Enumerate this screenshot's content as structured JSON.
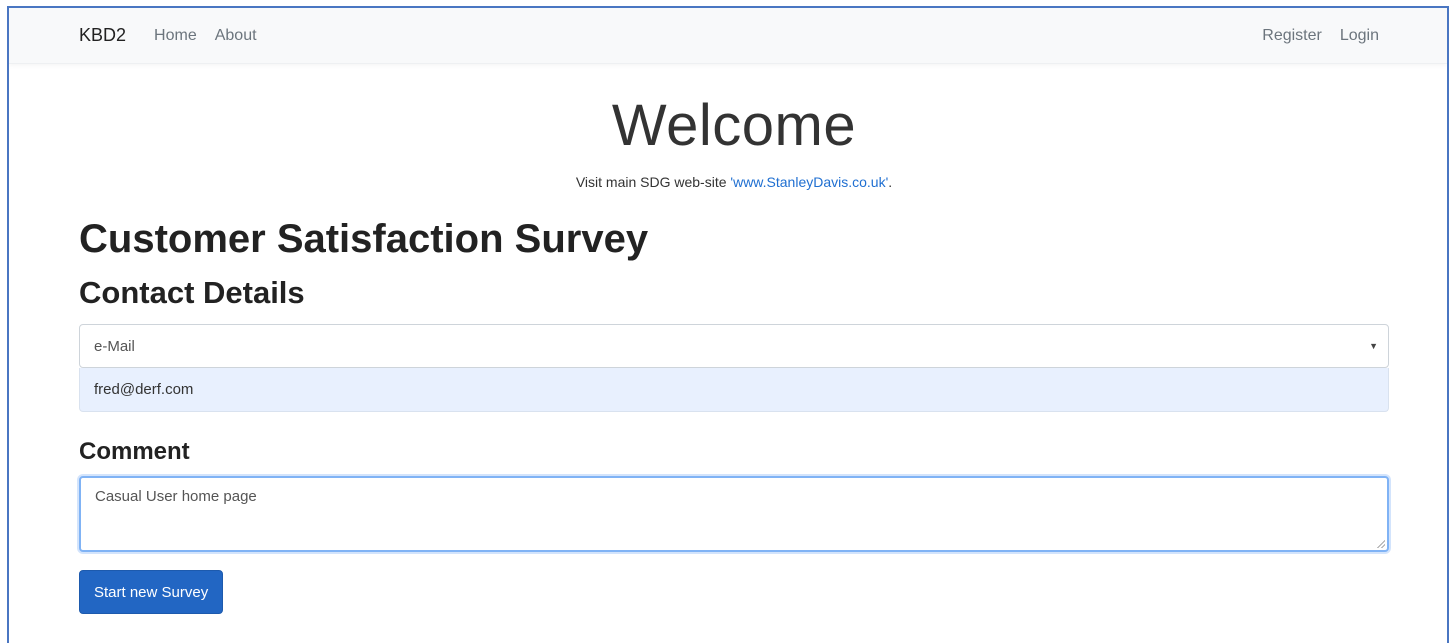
{
  "navbar": {
    "brand": "KBD2",
    "links_left": [
      "Home",
      "About"
    ],
    "links_right": [
      "Register",
      "Login"
    ]
  },
  "hero": {
    "title": "Welcome",
    "visit_prefix": "Visit main SDG web-site ",
    "visit_link": "'www.StanleyDavis.co.uk'",
    "visit_suffix": "."
  },
  "survey": {
    "title": "Customer Satisfaction Survey",
    "contact_heading": "Contact Details",
    "contact_type_selected": "e-Mail",
    "contact_value": "fred@derf.com",
    "comment_label": "Comment",
    "comment_value": "Casual User home page",
    "start_button": "Start new Survey"
  },
  "colors": {
    "frame_border": "#4a76c2",
    "link": "#1f6fd1",
    "primary_button": "#2266c3",
    "autofill_bg": "#e8f0fe",
    "focus_border": "#80b3f5"
  }
}
